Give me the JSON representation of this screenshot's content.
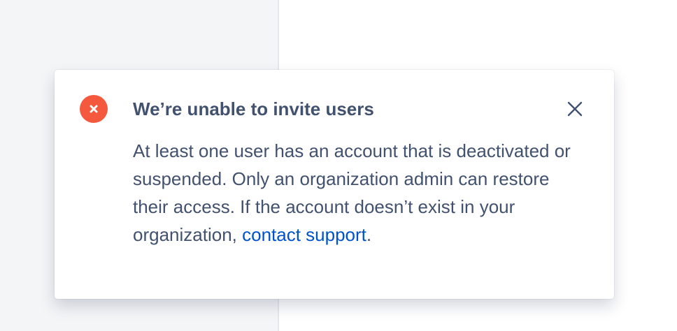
{
  "flag": {
    "title": "We’re unable to invite users",
    "description_text": "At least one user has an account that is deactivated or suspended. Only an organization admin can restore their access. If the account doesn’t exist in your organization, ",
    "link_text": "contact support",
    "trailing_text": ".",
    "icon": "error-icon",
    "close_icon": "close-icon"
  },
  "colors": {
    "error": "#f5593d",
    "text": "#42526e",
    "link": "#0052cc",
    "background_left": "#f4f5f7",
    "background_right": "#ffffff"
  }
}
